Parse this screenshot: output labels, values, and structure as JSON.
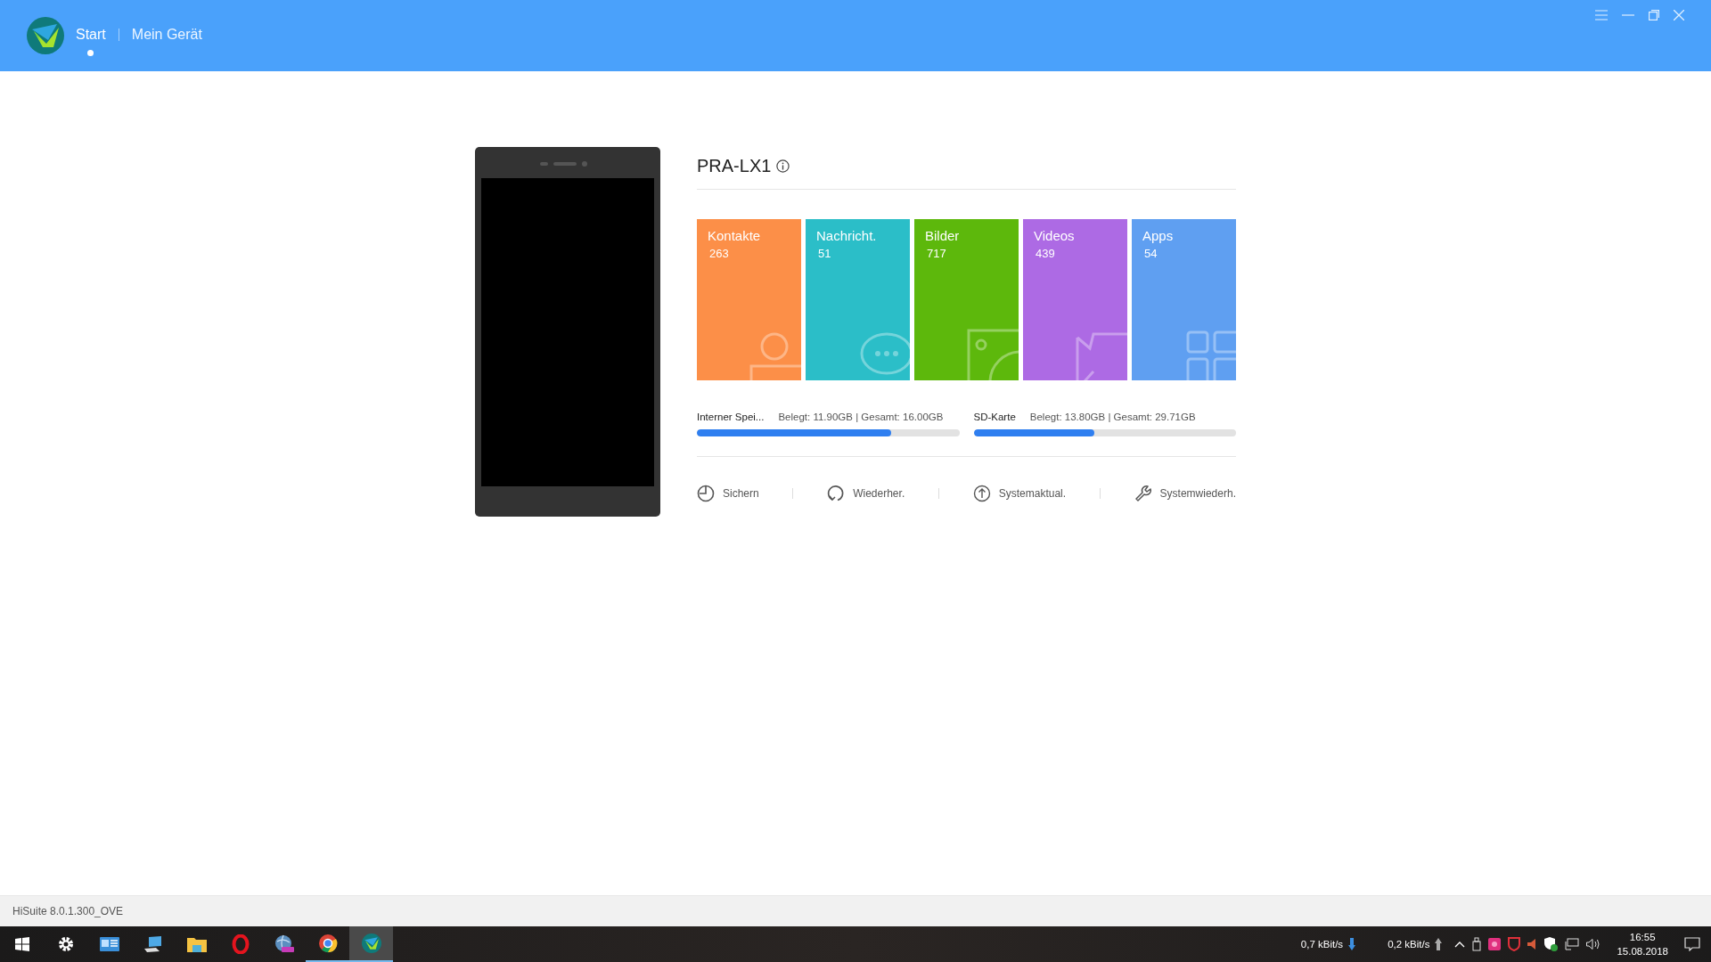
{
  "header": {
    "nav": [
      {
        "label": "Start",
        "selected": true
      },
      {
        "label": "Mein Gerät",
        "selected": false
      }
    ]
  },
  "device": {
    "name": "PRA-LX1",
    "tiles": [
      {
        "kind": "contacts",
        "label": "Kontakte",
        "count": "263",
        "color": "#fc8f48"
      },
      {
        "kind": "messages",
        "label": "Nachricht.",
        "count": "51",
        "color": "#2bbec8"
      },
      {
        "kind": "pictures",
        "label": "Bilder",
        "count": "717",
        "color": "#5db80c"
      },
      {
        "kind": "videos",
        "label": "Videos",
        "count": "439",
        "color": "#ad6ae4"
      },
      {
        "kind": "apps",
        "label": "Apps",
        "count": "54",
        "color": "#5f9ff1"
      }
    ],
    "storage": [
      {
        "label": "Interner Spei...",
        "usage": "Belegt: 11.90GB | Gesamt: 16.00GB",
        "level": 0.74
      },
      {
        "label": "SD-Karte",
        "usage": "Belegt: 13.80GB | Gesamt: 29.71GB",
        "level": 0.46
      }
    ],
    "actions": [
      {
        "kind": "backup",
        "label": "Sichern"
      },
      {
        "kind": "restore",
        "label": "Wiederher."
      },
      {
        "kind": "update",
        "label": "Systemaktual."
      },
      {
        "kind": "repair",
        "label": "Systemwiederh."
      }
    ]
  },
  "status_bar": {
    "version": "HiSuite 8.0.1.300_OVE"
  },
  "taskbar": {
    "items": [
      {
        "kind": "start",
        "running": false,
        "selected": false
      },
      {
        "kind": "settings",
        "running": false,
        "selected": false
      },
      {
        "kind": "card",
        "running": false,
        "selected": false
      },
      {
        "kind": "computer",
        "running": false,
        "selected": false
      },
      {
        "kind": "folder",
        "running": false,
        "selected": false
      },
      {
        "kind": "ring",
        "running": false,
        "selected": false
      },
      {
        "kind": "globe",
        "running": false,
        "selected": false
      },
      {
        "kind": "browser",
        "running": true,
        "selected": false
      },
      {
        "kind": "suite",
        "running": true,
        "selected": true
      }
    ],
    "download_rate": "0,7 kBit/s",
    "upload_rate": "0,2 kBit/s",
    "time": "16:55",
    "date": "15.08.2018"
  }
}
